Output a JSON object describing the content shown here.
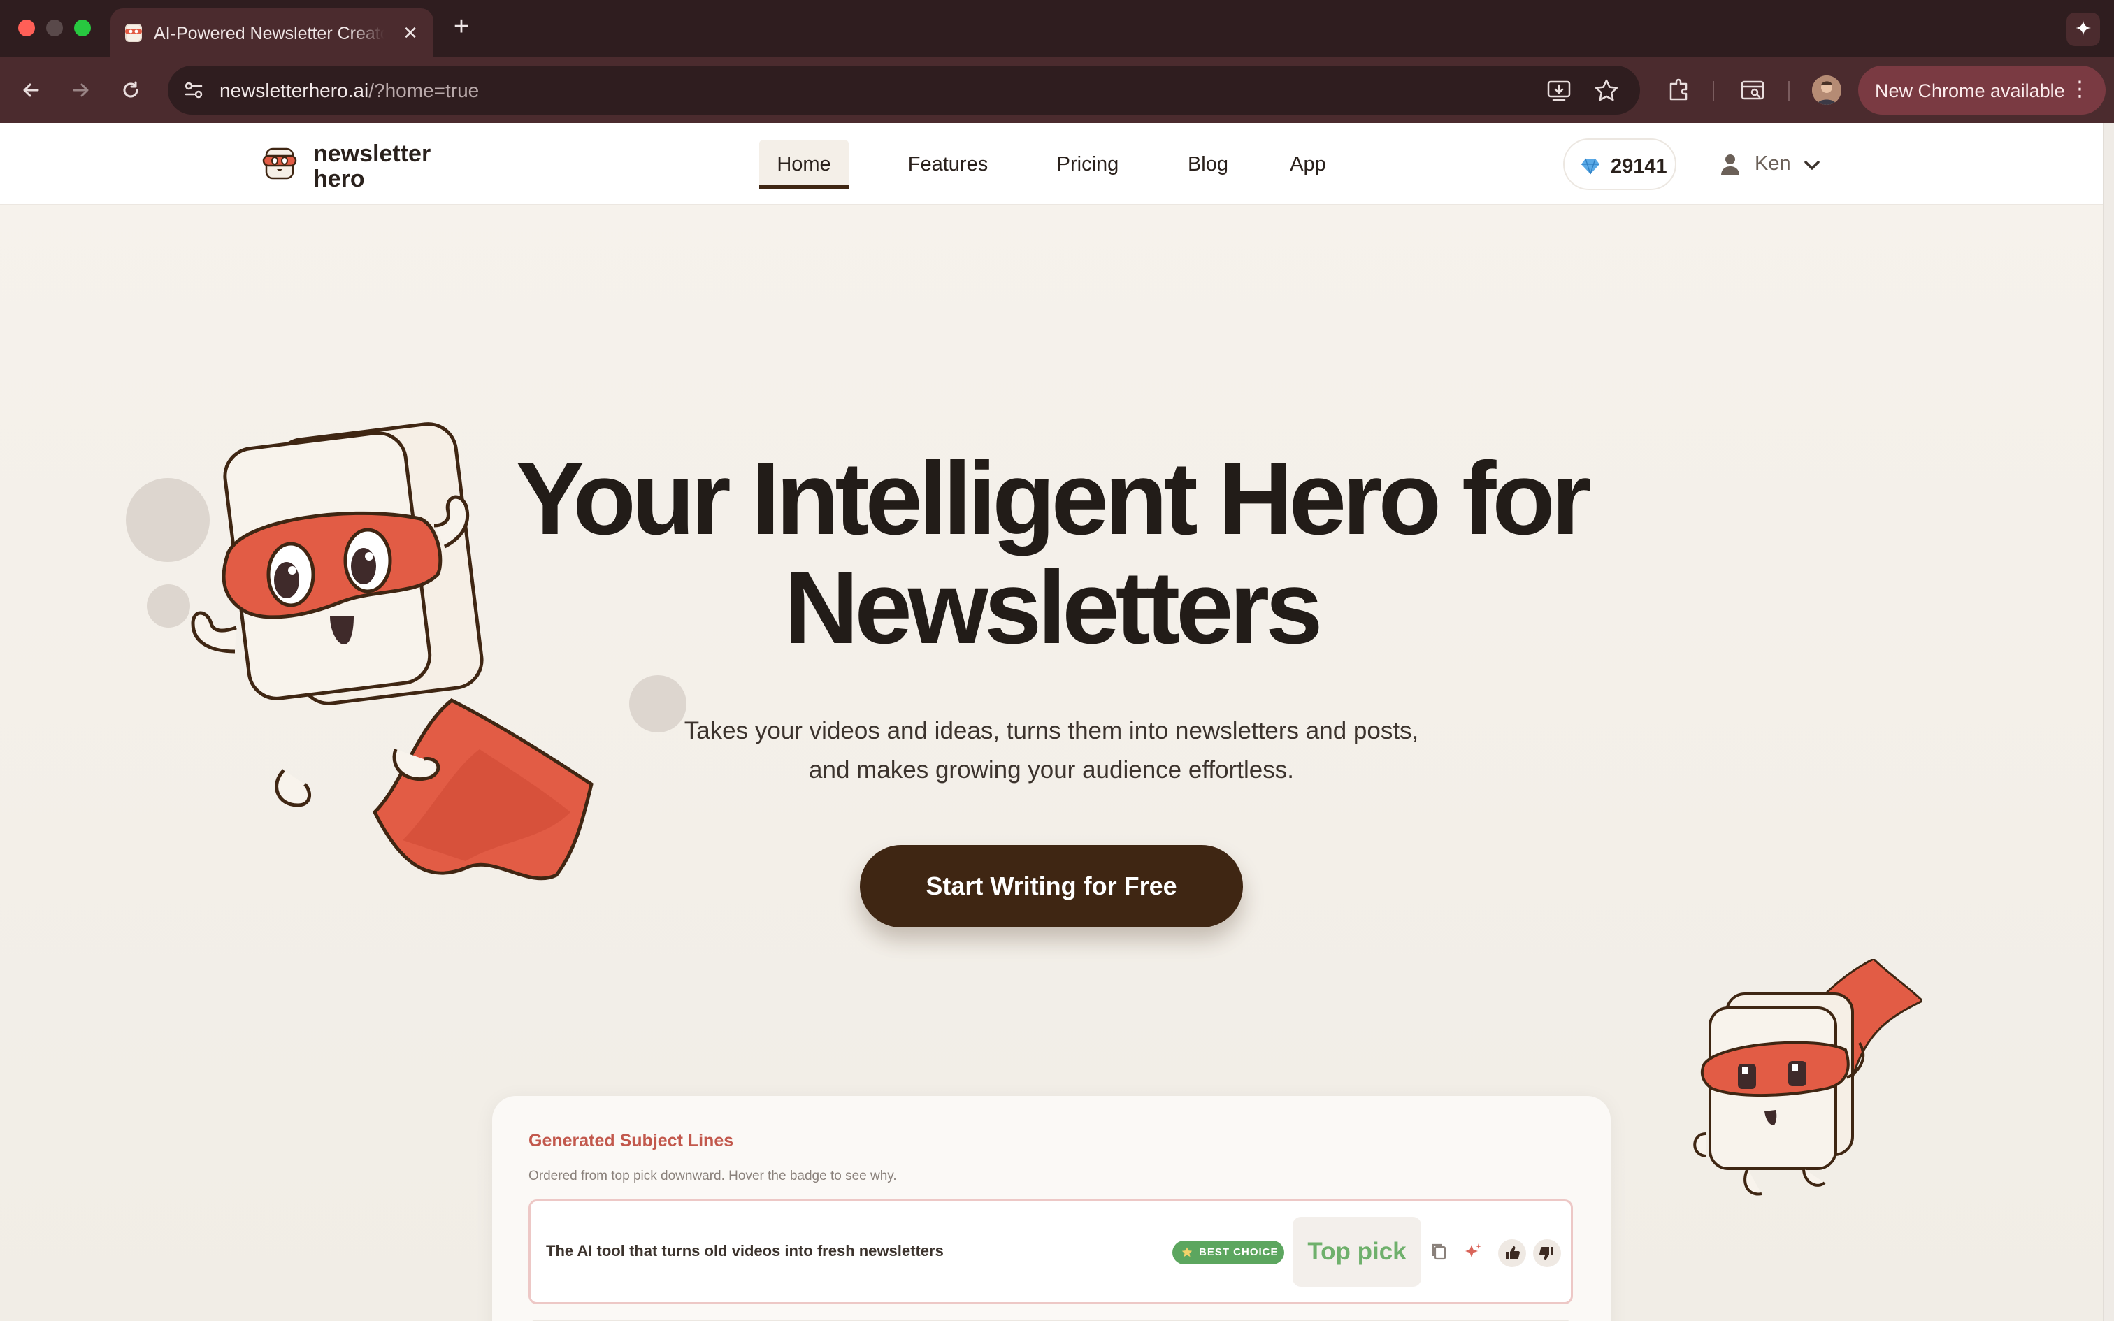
{
  "browser": {
    "tab_title": "AI-Powered Newsletter Creator",
    "tab_close": "✕",
    "new_tab": "+",
    "url_host": "newsletterhero.ai",
    "url_path": "/?home=true",
    "update_button": "New Chrome available",
    "menu_glyph": "⋮",
    "gemini_glyph": "✦"
  },
  "site": {
    "logo_line1": "newsletter",
    "logo_line2": "hero",
    "nav": [
      {
        "label": "Home",
        "active": true
      },
      {
        "label": "Features"
      },
      {
        "label": "Pricing"
      },
      {
        "label": "Blog"
      },
      {
        "label": "App"
      }
    ],
    "gems": "29141",
    "user": "Ken"
  },
  "hero": {
    "title_line1": "Your Intelligent Hero for",
    "title_line2": "Newsletters",
    "subtitle_line1": "Takes your videos and ideas, turns them into newsletters and posts,",
    "subtitle_line2": "and makes growing your audience effortless.",
    "cta": "Start Writing for Free"
  },
  "subject_lines": {
    "title": "Generated Subject Lines",
    "subtitle": "Ordered from top pick downward. Hover the badge to see why.",
    "rows": [
      {
        "text": "The AI tool that turns old videos into fresh newsletters",
        "badge": "BEST CHOICE",
        "label": "Top pick"
      }
    ]
  },
  "colors": {
    "brand_dark": "#3f2613",
    "brand_red": "#e25c45",
    "badge_green": "#5ca65f",
    "accent_title": "#c2584c"
  }
}
